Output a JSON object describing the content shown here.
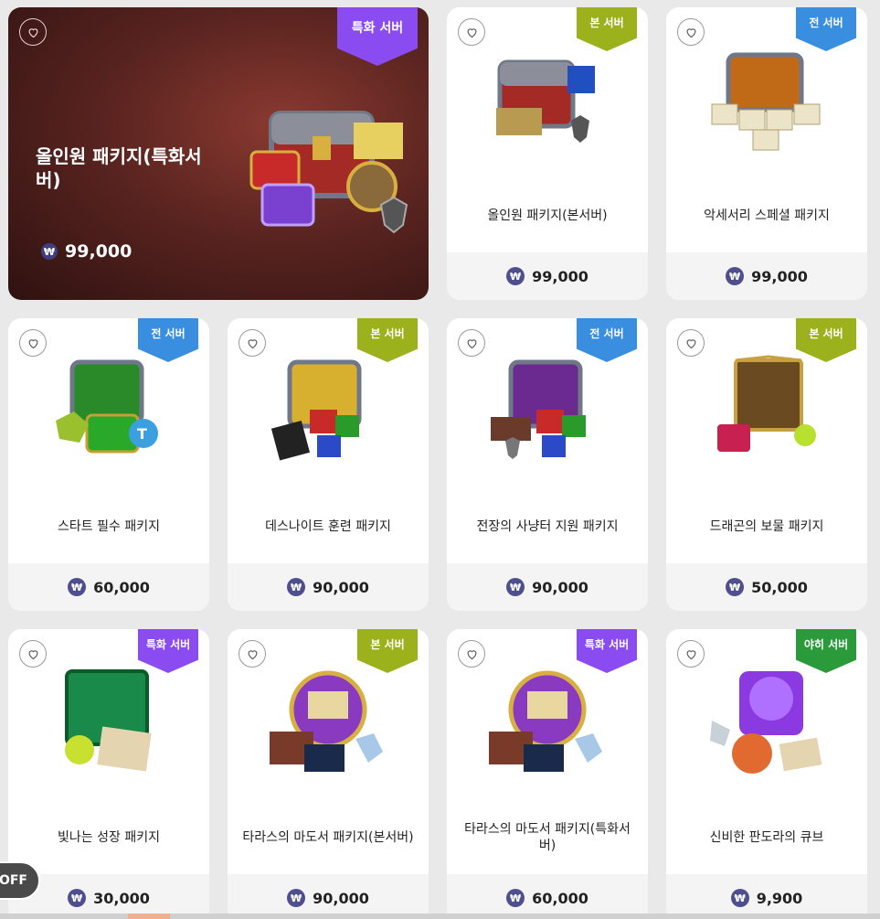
{
  "currency_symbol": "₩",
  "featured": {
    "name": "올인원 패키지(특화서버)",
    "price": "99,000",
    "badge": "특화 서버",
    "badge_color": "#8a4cf0"
  },
  "badge_colors": {
    "본 서버": "#9cb21c",
    "전 서버": "#3a8ee0",
    "특화 서버": "#8a4cf0",
    "야히 서버": "#2a9a3a"
  },
  "products": [
    {
      "name": "올인원 패키지(본서버)",
      "price": "99,000",
      "badge": "본 서버",
      "icon": "chest-weapons-icon"
    },
    {
      "name": "악세서리 스페셜 패키지",
      "price": "99,000",
      "badge": "전 서버",
      "icon": "chest-boxes-icon"
    },
    {
      "name": "스타트 필수 패키지",
      "price": "60,000",
      "badge": "전 서버",
      "icon": "green-chest-icon"
    },
    {
      "name": "데스나이트 훈련 패키지",
      "price": "90,000",
      "badge": "본 서버",
      "icon": "gold-chest-gifts-icon"
    },
    {
      "name": "전장의 사냥터 지원 패키지",
      "price": "90,000",
      "badge": "전 서버",
      "icon": "purple-chest-gifts-icon"
    },
    {
      "name": "드래곤의 보물 패키지",
      "price": "50,000",
      "badge": "본 서버",
      "icon": "treasure-box-potion-icon"
    },
    {
      "name": "빛나는 성장 패키지",
      "price": "30,000",
      "badge": "특화 서버",
      "icon": "emerald-chest-icon"
    },
    {
      "name": "타라스의 마도서 패키지(본서버)",
      "price": "90,000",
      "badge": "본 서버",
      "icon": "orb-spellbook-icon"
    },
    {
      "name": "타라스의 마도서 패키지(특화서버)",
      "price": "60,000",
      "badge": "특화 서버",
      "icon": "orb-spellbook-icon"
    },
    {
      "name": "신비한 판도라의 큐브",
      "price": "9,900",
      "badge": "야히 서버",
      "icon": "pandora-cube-icon"
    }
  ],
  "off_button": "OFF"
}
